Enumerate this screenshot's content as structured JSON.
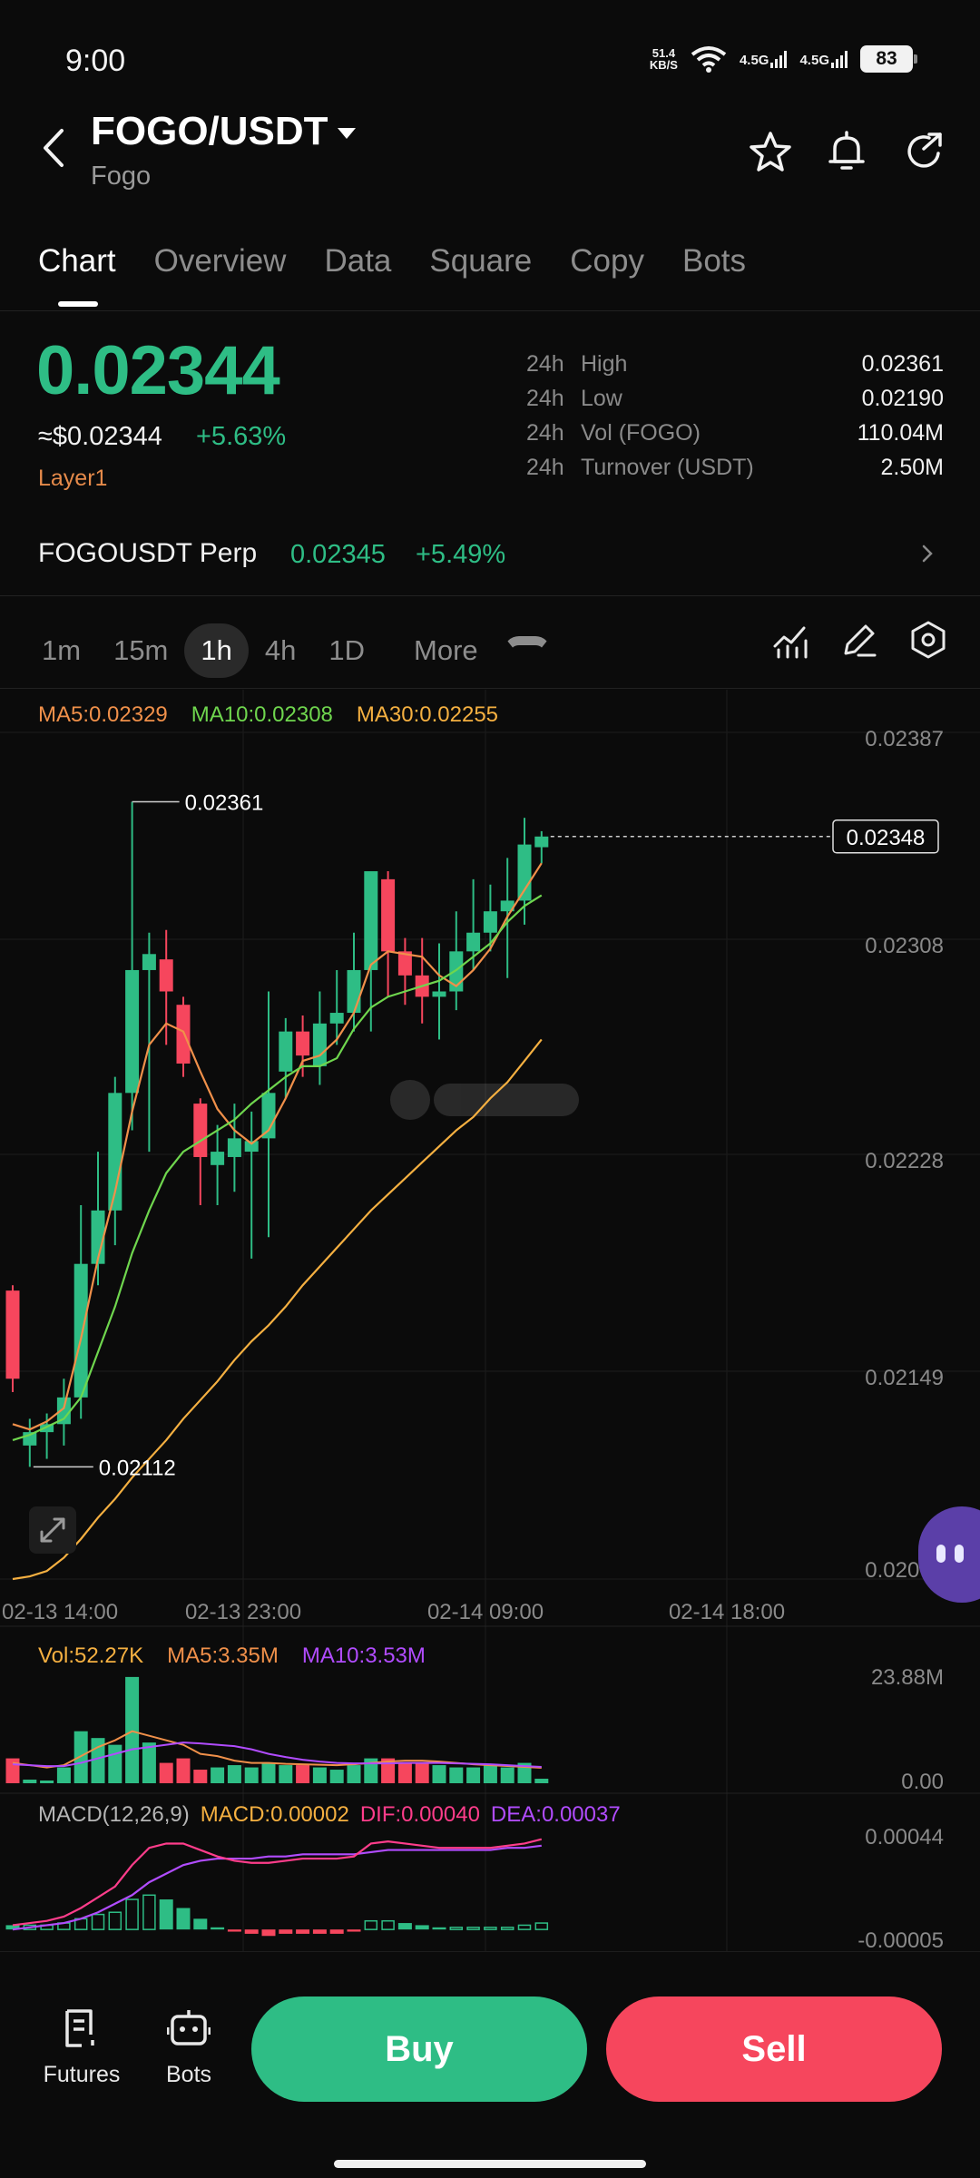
{
  "status_bar": {
    "time": "9:00",
    "net_speed_value": "51.4",
    "net_speed_unit": "KB/S",
    "sim1": "4.5G",
    "sim2": "4.5G",
    "battery": "83",
    "icons": [
      "wifi-icon",
      "signal-icon",
      "battery-icon"
    ]
  },
  "header": {
    "pair": "FOGO/USDT",
    "name": "Fogo",
    "icons": [
      "back-icon",
      "star-icon",
      "bell-icon",
      "share-icon"
    ]
  },
  "tabs": [
    "Chart",
    "Overview",
    "Data",
    "Square",
    "Copy",
    "Bots"
  ],
  "active_tab": "Chart",
  "price": {
    "last": "0.02344",
    "usd": "≈$0.02344",
    "change_pct": "+5.63%",
    "tag": "Layer1"
  },
  "stats": [
    {
      "period": "24h",
      "label": "High",
      "value": "0.02361"
    },
    {
      "period": "24h",
      "label": "Low",
      "value": "0.02190"
    },
    {
      "period": "24h",
      "label": "Vol (FOGO)",
      "value": "110.04M"
    },
    {
      "period": "24h",
      "label": "Turnover (USDT)",
      "value": "2.50M"
    }
  ],
  "perp": {
    "name": "FOGOUSDT Perp",
    "price": "0.02345",
    "change_pct": "+5.49%"
  },
  "intervals": [
    "1m",
    "15m",
    "1h",
    "4h",
    "1D"
  ],
  "selected_interval": "1h",
  "more_label": "More",
  "chart_tools": [
    "indicator-icon",
    "draw-icon",
    "settings-icon"
  ],
  "ma_legend": {
    "ma5": "MA5:0.02329",
    "ma10": "MA10:0.02308",
    "ma30": "MA30:0.02255"
  },
  "vol_legend": {
    "vol": "Vol:52.27K",
    "ma5": "MA5:3.35M",
    "ma10": "MA10:3.53M"
  },
  "macd_legend": {
    "name": "MACD(12,26,9)",
    "macd": "MACD:0.00002",
    "dif": "DIF:0.00040",
    "dea": "DEA:0.00037"
  },
  "colors": {
    "up": "#2ebd85",
    "down": "#f6465d",
    "ma5": "#f0904a",
    "ma10": "#6fd64e",
    "ma30": "#f5b041",
    "dif": "#ff3d8b",
    "dea": "#b14cff"
  },
  "chart_data": {
    "type": "candlestick",
    "price_axis": [
      "0.02387",
      "0.02308",
      "0.02228",
      "0.02149",
      "0.02070"
    ],
    "ylim": [
      0.0207,
      0.02387
    ],
    "time_axis": [
      "02-13 14:00",
      "02-13 23:00",
      "02-14 09:00",
      "02-14 18:00"
    ],
    "high_marker": "0.02361",
    "low_marker": "0.02112",
    "current_marker": "0.02348",
    "candles": [
      {
        "o": 0.02178,
        "h": 0.0218,
        "l": 0.0214,
        "c": 0.02145
      },
      {
        "o": 0.0212,
        "h": 0.0213,
        "l": 0.02112,
        "c": 0.02125
      },
      {
        "o": 0.02125,
        "h": 0.02132,
        "l": 0.02115,
        "c": 0.02128
      },
      {
        "o": 0.02128,
        "h": 0.02145,
        "l": 0.0212,
        "c": 0.02138
      },
      {
        "o": 0.02138,
        "h": 0.0221,
        "l": 0.0213,
        "c": 0.02188
      },
      {
        "o": 0.02188,
        "h": 0.0223,
        "l": 0.0218,
        "c": 0.02208
      },
      {
        "o": 0.02208,
        "h": 0.02258,
        "l": 0.02195,
        "c": 0.02252
      },
      {
        "o": 0.02252,
        "h": 0.02361,
        "l": 0.02238,
        "c": 0.02298
      },
      {
        "o": 0.02298,
        "h": 0.02312,
        "l": 0.0223,
        "c": 0.02304
      },
      {
        "o": 0.02302,
        "h": 0.02313,
        "l": 0.0227,
        "c": 0.0229
      },
      {
        "o": 0.02285,
        "h": 0.02288,
        "l": 0.02258,
        "c": 0.02263
      },
      {
        "o": 0.02248,
        "h": 0.0225,
        "l": 0.0221,
        "c": 0.02228
      },
      {
        "o": 0.02225,
        "h": 0.0224,
        "l": 0.0221,
        "c": 0.0223
      },
      {
        "o": 0.02228,
        "h": 0.02248,
        "l": 0.02215,
        "c": 0.02235
      },
      {
        "o": 0.0223,
        "h": 0.02245,
        "l": 0.0219,
        "c": 0.02234
      },
      {
        "o": 0.02235,
        "h": 0.0229,
        "l": 0.02198,
        "c": 0.02252
      },
      {
        "o": 0.0226,
        "h": 0.0228,
        "l": 0.0225,
        "c": 0.02275
      },
      {
        "o": 0.02275,
        "h": 0.02281,
        "l": 0.02258,
        "c": 0.02266
      },
      {
        "o": 0.02262,
        "h": 0.0229,
        "l": 0.02255,
        "c": 0.02278
      },
      {
        "o": 0.02278,
        "h": 0.02298,
        "l": 0.0227,
        "c": 0.02282
      },
      {
        "o": 0.02282,
        "h": 0.02312,
        "l": 0.02275,
        "c": 0.02298
      },
      {
        "o": 0.02298,
        "h": 0.0233,
        "l": 0.02275,
        "c": 0.02335
      },
      {
        "o": 0.02332,
        "h": 0.02335,
        "l": 0.02288,
        "c": 0.02305
      },
      {
        "o": 0.02305,
        "h": 0.0231,
        "l": 0.02285,
        "c": 0.02296
      },
      {
        "o": 0.02296,
        "h": 0.0231,
        "l": 0.02278,
        "c": 0.02288
      },
      {
        "o": 0.02288,
        "h": 0.02308,
        "l": 0.02272,
        "c": 0.0229
      },
      {
        "o": 0.0229,
        "h": 0.0232,
        "l": 0.02283,
        "c": 0.02305
      },
      {
        "o": 0.02305,
        "h": 0.02332,
        "l": 0.02298,
        "c": 0.02312
      },
      {
        "o": 0.02312,
        "h": 0.0233,
        "l": 0.02305,
        "c": 0.0232
      },
      {
        "o": 0.0232,
        "h": 0.0234,
        "l": 0.02295,
        "c": 0.02324
      },
      {
        "o": 0.02324,
        "h": 0.02355,
        "l": 0.02315,
        "c": 0.02345
      },
      {
        "o": 0.02344,
        "h": 0.0235,
        "l": 0.02338,
        "c": 0.02348
      }
    ],
    "ma5": [
      0.02128,
      0.02126,
      0.02129,
      0.02134,
      0.0216,
      0.0219,
      0.02215,
      0.02245,
      0.0227,
      0.02278,
      0.02275,
      0.0226,
      0.02246,
      0.02238,
      0.02233,
      0.02238,
      0.0225,
      0.02264,
      0.02266,
      0.02272,
      0.02282,
      0.023,
      0.02305,
      0.02304,
      0.02303,
      0.02296,
      0.02292,
      0.02298,
      0.02306,
      0.02318,
      0.02328,
      0.02338
    ],
    "ma10": [
      0.02122,
      0.02124,
      0.02127,
      0.0213,
      0.02138,
      0.02155,
      0.02172,
      0.02192,
      0.02208,
      0.02222,
      0.0223,
      0.02234,
      0.02238,
      0.02242,
      0.02248,
      0.02253,
      0.02258,
      0.02262,
      0.02262,
      0.02265,
      0.02276,
      0.02284,
      0.02288,
      0.0229,
      0.02292,
      0.02294,
      0.02298,
      0.02303,
      0.02308,
      0.02316,
      0.02322,
      0.02326
    ],
    "ma30": [
      0.0207,
      0.02071,
      0.02073,
      0.02078,
      0.02085,
      0.02093,
      0.021,
      0.02108,
      0.02115,
      0.02122,
      0.0213,
      0.02137,
      0.02144,
      0.02152,
      0.02159,
      0.02165,
      0.02172,
      0.0218,
      0.02187,
      0.02194,
      0.02201,
      0.02208,
      0.02214,
      0.0222,
      0.02226,
      0.02232,
      0.02238,
      0.02243,
      0.0225,
      0.02256,
      0.02264,
      0.02272
    ],
    "volume_axis": [
      "23.88M",
      "0.00"
    ],
    "volume_max": 23.88,
    "volumes": [
      5.5,
      0.8,
      0.6,
      3.5,
      11.5,
      10.0,
      8.5,
      23.5,
      9.0,
      4.5,
      5.5,
      3.0,
      3.5,
      4.0,
      3.5,
      4.5,
      4.0,
      4.0,
      3.5,
      3.0,
      4.0,
      5.5,
      5.5,
      4.5,
      4.5,
      4.0,
      3.5,
      3.5,
      4.0,
      3.5,
      4.5,
      1.0
    ],
    "vol_ma5": [
      4.5,
      4.0,
      3.5,
      4.0,
      6.0,
      8.0,
      9.5,
      11.5,
      10.5,
      9.5,
      8.5,
      6.5,
      6.0,
      5.0,
      4.5,
      4.5,
      4.3,
      4.2,
      4.1,
      4.0,
      4.2,
      4.5,
      4.8,
      5.0,
      5.0,
      4.8,
      4.5,
      4.2,
      4.0,
      3.8,
      3.6,
      3.4
    ],
    "vol_ma10": [
      4.2,
      4.0,
      3.8,
      3.8,
      4.5,
      5.5,
      6.5,
      7.5,
      8.0,
      8.5,
      9.0,
      8.8,
      8.5,
      8.2,
      7.5,
      6.5,
      5.8,
      5.2,
      4.8,
      4.5,
      4.4,
      4.4,
      4.4,
      4.5,
      4.5,
      4.5,
      4.4,
      4.3,
      4.2,
      4.0,
      3.8,
      3.6
    ],
    "macd_axis": [
      "0.00044",
      "-0.00005"
    ],
    "macd_range": [
      -5e-05,
      0.00044
    ],
    "dif": [
      2e-05,
      3e-05,
      4e-05,
      6e-05,
      0.0001,
      0.00015,
      0.0002,
      0.0003,
      0.00038,
      0.0004,
      0.0004,
      0.00037,
      0.00034,
      0.00032,
      0.00031,
      0.00031,
      0.00032,
      0.00033,
      0.00033,
      0.00033,
      0.00034,
      0.0004,
      0.00041,
      0.0004,
      0.00039,
      0.00038,
      0.00038,
      0.00038,
      0.00038,
      0.00039,
      0.0004,
      0.00042
    ],
    "dea": [
      0.0,
      1e-05,
      2e-05,
      3e-05,
      5e-05,
      8e-05,
      0.00012,
      0.00016,
      0.00022,
      0.00026,
      0.0003,
      0.00032,
      0.00033,
      0.00033,
      0.00033,
      0.00034,
      0.00034,
      0.00035,
      0.00035,
      0.00035,
      0.00035,
      0.00036,
      0.00037,
      0.00037,
      0.00037,
      0.00037,
      0.00037,
      0.00037,
      0.00037,
      0.00038,
      0.00038,
      0.00039
    ],
    "macd_hist": [
      2e-05,
      2e-05,
      2e-05,
      3e-05,
      5e-05,
      7e-05,
      8e-05,
      0.00014,
      0.00016,
      0.00014,
      0.0001,
      5e-05,
      1e-05,
      -1e-05,
      -2e-05,
      -3e-05,
      -2e-05,
      -2e-05,
      -2e-05,
      -2e-05,
      -1e-05,
      4e-05,
      4e-05,
      3e-05,
      2e-05,
      1e-05,
      1e-05,
      1e-05,
      1e-05,
      1e-05,
      2e-05,
      3e-05
    ]
  },
  "bottom_nav": {
    "futures": "Futures",
    "bots": "Bots",
    "buy": "Buy",
    "sell": "Sell"
  }
}
